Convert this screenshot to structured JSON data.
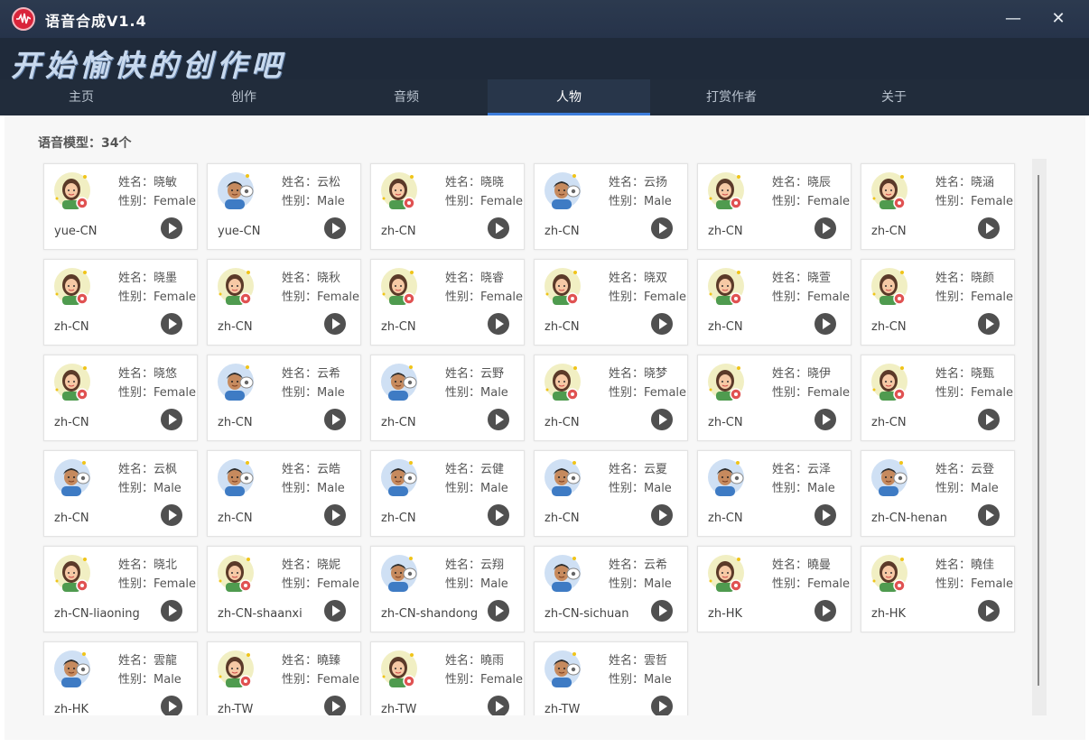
{
  "app": {
    "title": "语音合成V1.4",
    "banner": "开始愉快的创作吧",
    "minimize_glyph": "—",
    "close_glyph": "✕"
  },
  "tabs": [
    {
      "label": "主页"
    },
    {
      "label": "创作"
    },
    {
      "label": "音频"
    },
    {
      "label": "人物",
      "active": true
    },
    {
      "label": "打赏作者"
    },
    {
      "label": "关于"
    }
  ],
  "colors": {
    "accent": "#3d7ddb",
    "titlebar": "#2c3a4f",
    "male_avatar_bg": "#cfe0f4",
    "female_avatar_bg": "#f1efc3"
  },
  "labels": {
    "name_prefix": "姓名：",
    "gender_prefix": "性别："
  },
  "models": {
    "count_text": "语音模型：34个",
    "items": [
      {
        "name": "晓敏",
        "gender": "Female",
        "locale": "yue-CN"
      },
      {
        "name": "云松",
        "gender": "Male",
        "locale": "yue-CN"
      },
      {
        "name": "晓晓",
        "gender": "Female",
        "locale": "zh-CN"
      },
      {
        "name": "云扬",
        "gender": "Male",
        "locale": "zh-CN"
      },
      {
        "name": "晓辰",
        "gender": "Female",
        "locale": "zh-CN"
      },
      {
        "name": "晓涵",
        "gender": "Female",
        "locale": "zh-CN"
      },
      {
        "name": "晓墨",
        "gender": "Female",
        "locale": "zh-CN"
      },
      {
        "name": "晓秋",
        "gender": "Female",
        "locale": "zh-CN"
      },
      {
        "name": "晓睿",
        "gender": "Female",
        "locale": "zh-CN"
      },
      {
        "name": "晓双",
        "gender": "Female",
        "locale": "zh-CN"
      },
      {
        "name": "晓萱",
        "gender": "Female",
        "locale": "zh-CN"
      },
      {
        "name": "晓颜",
        "gender": "Female",
        "locale": "zh-CN"
      },
      {
        "name": "晓悠",
        "gender": "Female",
        "locale": "zh-CN"
      },
      {
        "name": "云希",
        "gender": "Male",
        "locale": "zh-CN"
      },
      {
        "name": "云野",
        "gender": "Male",
        "locale": "zh-CN"
      },
      {
        "name": "晓梦",
        "gender": "Female",
        "locale": "zh-CN"
      },
      {
        "name": "晓伊",
        "gender": "Female",
        "locale": "zh-CN"
      },
      {
        "name": "晓甄",
        "gender": "Female",
        "locale": "zh-CN"
      },
      {
        "name": "云枫",
        "gender": "Male",
        "locale": "zh-CN"
      },
      {
        "name": "云皓",
        "gender": "Male",
        "locale": "zh-CN"
      },
      {
        "name": "云健",
        "gender": "Male",
        "locale": "zh-CN"
      },
      {
        "name": "云夏",
        "gender": "Male",
        "locale": "zh-CN"
      },
      {
        "name": "云泽",
        "gender": "Male",
        "locale": "zh-CN"
      },
      {
        "name": "云登",
        "gender": "Male",
        "locale": "zh-CN-henan"
      },
      {
        "name": "晓北",
        "gender": "Female",
        "locale": "zh-CN-liaoning"
      },
      {
        "name": "晓妮",
        "gender": "Female",
        "locale": "zh-CN-shaanxi"
      },
      {
        "name": "云翔",
        "gender": "Male",
        "locale": "zh-CN-shandong"
      },
      {
        "name": "云希",
        "gender": "Male",
        "locale": "zh-CN-sichuan"
      },
      {
        "name": "曉曼",
        "gender": "Female",
        "locale": "zh-HK"
      },
      {
        "name": "曉佳",
        "gender": "Female",
        "locale": "zh-HK"
      },
      {
        "name": "雲龍",
        "gender": "Male",
        "locale": "zh-HK"
      },
      {
        "name": "曉臻",
        "gender": "Female",
        "locale": "zh-TW"
      },
      {
        "name": "曉雨",
        "gender": "Female",
        "locale": "zh-TW"
      },
      {
        "name": "雲哲",
        "gender": "Male",
        "locale": "zh-TW"
      }
    ]
  }
}
